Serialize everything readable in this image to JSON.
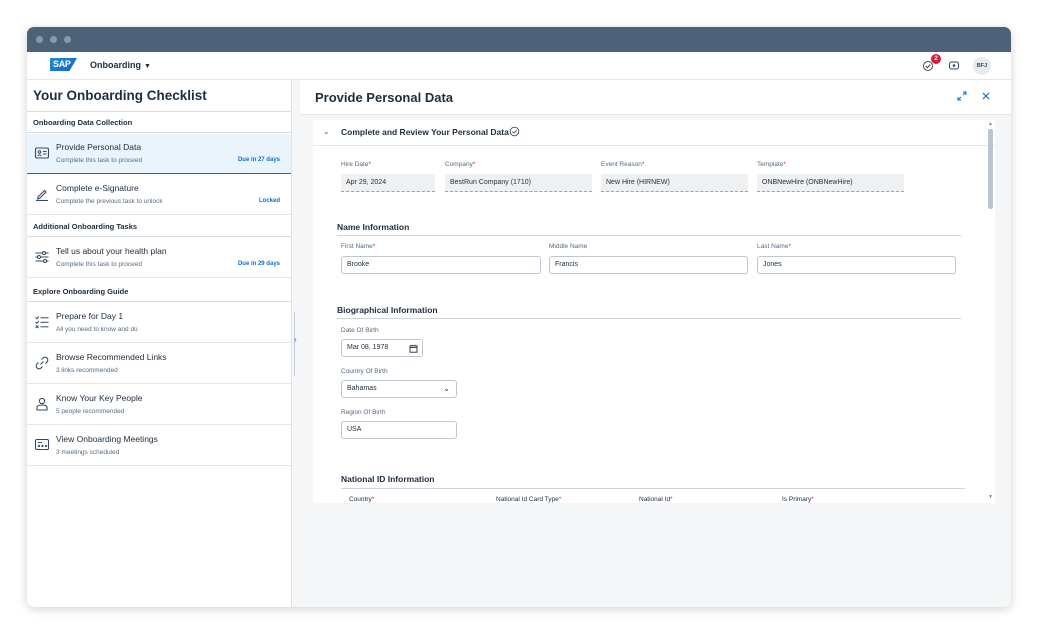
{
  "shell": {
    "logo_text": "SAP",
    "app_name": "Onboarding",
    "notification_count": "2",
    "user_initials": "BFJ",
    "brand_color": "#0a6ed1",
    "titlebar_color": "#4d6179"
  },
  "checklist": {
    "title": "Your Onboarding Checklist",
    "groups": [
      {
        "label": "Onboarding Data Collection",
        "items": [
          {
            "title": "Provide Personal Data",
            "subtitle": "Complete this task to proceed",
            "status": "Due in 27 days",
            "icon": "personal-data-icon"
          },
          {
            "title": "Complete e-Signature",
            "subtitle": "Complete the previous task to unlock",
            "status": "Locked",
            "icon": "signature-icon"
          }
        ]
      },
      {
        "label": "Additional Onboarding Tasks",
        "items": [
          {
            "title": "Tell us about your health plan",
            "subtitle": "Complete this task to proceed",
            "status": "Due in 29 days",
            "icon": "health-plan-icon"
          }
        ]
      },
      {
        "label": "Explore Onboarding Guide",
        "items": [
          {
            "title": "Prepare for Day 1",
            "subtitle": "All you need to know and do",
            "icon": "checklist-icon"
          },
          {
            "title": "Browse Recommended Links",
            "subtitle": "3 links recommended",
            "icon": "link-icon"
          },
          {
            "title": "Know Your Key People",
            "subtitle": "5 people recommended",
            "icon": "people-icon"
          },
          {
            "title": "View Onboarding Meetings",
            "subtitle": "3 meetings scheduled",
            "icon": "meetings-icon"
          }
        ]
      }
    ]
  },
  "detail": {
    "title": "Provide Personal Data",
    "section_title": "Complete and Review Your Personal Data",
    "job": {
      "hire_date_label": "Hire Date",
      "hire_date": "Apr 29, 2024",
      "company_label": "Company",
      "company": "BestRun Company (1710)",
      "event_reason_label": "Event Reason",
      "event_reason": "New Hire (HIRNEW)",
      "template_label": "Template",
      "template": "ONBNewHire (ONBNewHire)"
    },
    "name_info": {
      "heading": "Name Information",
      "first_name_label": "First Name",
      "first_name": "Brooke",
      "middle_name_label": "Middle Name",
      "middle_name": "Francis",
      "last_name_label": "Last Name",
      "last_name": "Jones"
    },
    "bio_info": {
      "heading": "Biographical Information",
      "dob_label": "Date Of Birth",
      "dob": "Mar 08, 1978",
      "country_label": "Country Of Birth",
      "country": "Bahamas",
      "region_label": "Region Of Birth",
      "region": "USA"
    },
    "national_id": {
      "heading": "National ID Information",
      "columns": [
        "Country",
        "National Id Card Type",
        "National Id",
        "Is Primary"
      ]
    },
    "required_marker": "*"
  }
}
